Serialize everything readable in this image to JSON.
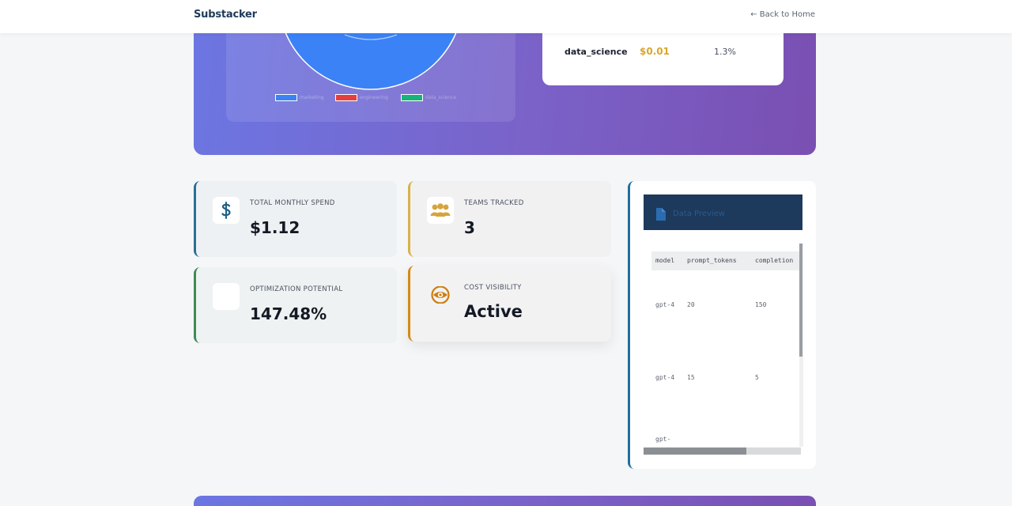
{
  "app": {
    "brand": "Substacker",
    "back_link": "← Back to Home"
  },
  "hero": {
    "legend": [
      {
        "label": "marketing",
        "color": "#3b82f6"
      },
      {
        "label": "engineering",
        "color": "#e53e3e"
      },
      {
        "label": "data_science",
        "color": "#16b37a"
      }
    ],
    "cost_table": {
      "rows": [
        {
          "team": "data_science",
          "cost": "$0.01",
          "share": "1.3%"
        }
      ]
    }
  },
  "stats": {
    "total_spend": {
      "label": "TOTAL MONTHLY SPEND",
      "value": "$1.12",
      "icon": "dollar-icon"
    },
    "teams_tracked": {
      "label": "TEAMS TRACKED",
      "value": "3",
      "icon": "users-icon"
    },
    "optimization": {
      "label": "OPTIMIZATION POTENTIAL",
      "value": "147.48%",
      "icon": "chart-icon"
    },
    "visibility": {
      "label": "COST VISIBILITY",
      "value": "Active",
      "icon": "eye-icon"
    }
  },
  "preview": {
    "title": "Data Preview",
    "icon": "file-icon",
    "columns": [
      "model",
      "prompt_tokens",
      "completion"
    ],
    "rows": [
      [
        "gpt-4",
        "20",
        "150"
      ],
      [
        "gpt-4",
        "15",
        "5"
      ],
      [
        "gpt-",
        "",
        ""
      ]
    ]
  },
  "colors": {
    "accent_blue": "#2a6f95",
    "accent_gold": "#d8a72c",
    "accent_green": "#3f8a55",
    "accent_orange": "#d68a18",
    "hero_gradient_start": "#6c76e2",
    "hero_gradient_end": "#7a4fb2",
    "preview_header": "#1d3a5c"
  }
}
